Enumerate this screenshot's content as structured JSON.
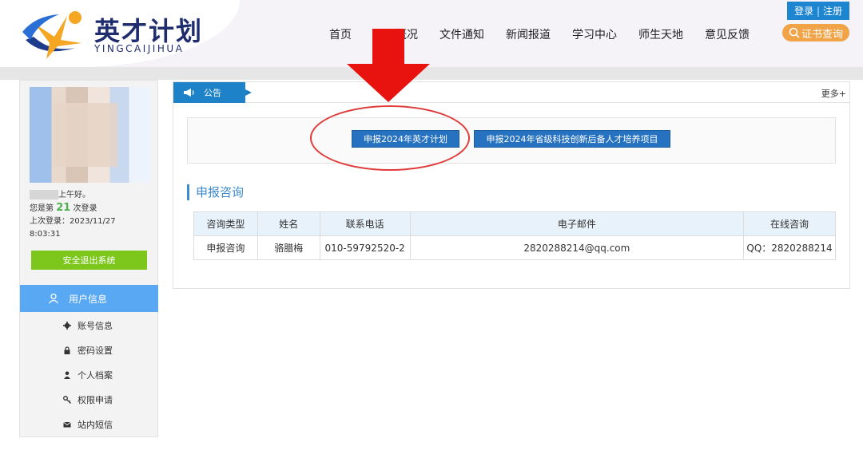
{
  "header": {
    "logo_title": "英才计划",
    "logo_subtitle": "YINGCAIJIHUA",
    "nav": [
      "首页",
      "项目概况",
      "文件通知",
      "新闻报道",
      "学习中心",
      "师生天地",
      "意见反馈"
    ],
    "login": "登录",
    "register": "注册",
    "cert_search": "证书查询"
  },
  "user": {
    "greeting_suffix": "上午好。",
    "login_prefix": "您是第",
    "login_count": "21",
    "login_suffix": "次登录",
    "last_login_label": "上次登录：2023/11/27",
    "last_login_time": "8:03:31",
    "logout": "安全退出系统"
  },
  "sidebar": {
    "head": "用户信息",
    "items": [
      {
        "label": "账号信息",
        "icon": "gear-icon"
      },
      {
        "label": "密码设置",
        "icon": "lock-icon"
      },
      {
        "label": "个人档案",
        "icon": "person-icon"
      },
      {
        "label": "权限申请",
        "icon": "key-icon"
      },
      {
        "label": "站内短信",
        "icon": "mail-icon"
      }
    ]
  },
  "notice": {
    "tab": "公告",
    "text": "·",
    "more": "更多+"
  },
  "apply": {
    "btn1": "申报2024年英才计划",
    "btn2": "申报2024年省级科技创新后备人才培养项目"
  },
  "consult": {
    "title": "申报咨询",
    "headers": [
      "咨询类型",
      "姓名",
      "联系电话",
      "电子邮件",
      "在线咨询"
    ],
    "row": [
      "申报咨询",
      "骆腊梅",
      "010-59792520-2",
      "2820288214@qq.com",
      "QQ：2820288214"
    ]
  },
  "colors": {
    "accent_blue": "#1e82c8",
    "logout_green": "#7dc71c",
    "menu_blue": "#58a8f4",
    "cert_orange": "#f1a347",
    "annotation_red": "#e03a3a"
  }
}
